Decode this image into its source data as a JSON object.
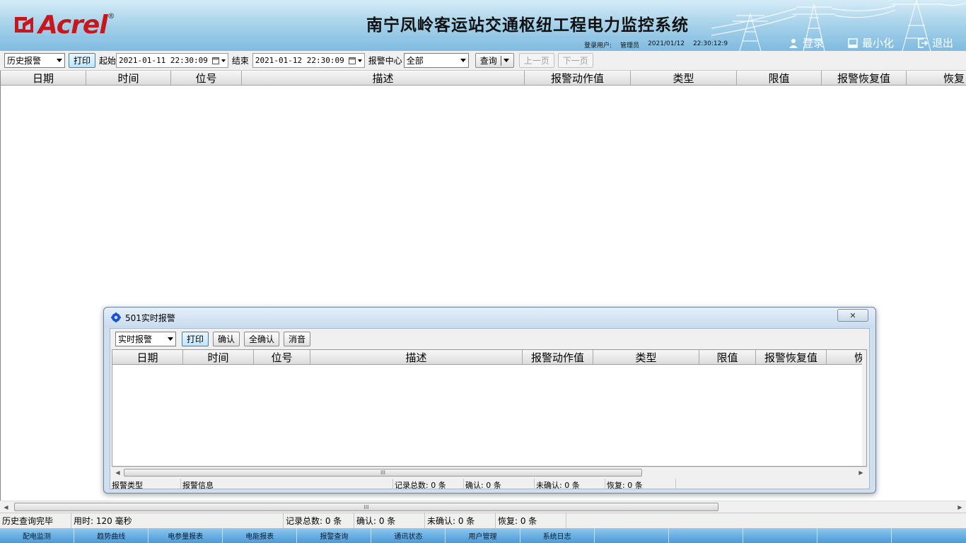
{
  "header": {
    "brand": "Acrel",
    "title": "南宁凤岭客运站交通枢纽工程电力监控系统",
    "login_label": "登录用户:",
    "login_user": "管理员",
    "date": "2021/01/12",
    "time": "22:30:12:9",
    "buttons": {
      "login": "登录",
      "minimize": "最小化",
      "exit": "退出"
    },
    "colors": {
      "brand": "#c8161d",
      "header_bg": "#a9d3ea"
    }
  },
  "toolbar": {
    "mode": "历史报警",
    "print": "打印",
    "start_label": "起始",
    "start_value": "2021-01-11  22:30:09",
    "end_label": "结束",
    "end_value": "2021-01-12  22:30:09",
    "center_label": "报警中心",
    "center_value": "全部",
    "query": "查询",
    "prev": "上一页",
    "next": "下一页"
  },
  "grid": {
    "columns": [
      "日期",
      "时间",
      "位号",
      "描述",
      "报警动作值",
      "类型",
      "限值",
      "报警恢复值",
      "恢复"
    ]
  },
  "statusbar": {
    "state": "历史查询完毕",
    "elapsed": "用时: 120 毫秒",
    "total": "记录总数: 0 条",
    "confirmed": "确认: 0 条",
    "unconfirmed": "未确认: 0 条",
    "restored": "恢复: 0 条"
  },
  "bottomnav": [
    "配电监测",
    "趋势曲线",
    "电参量报表",
    "电能报表",
    "报警查询",
    "通讯状态",
    "用户管理",
    "系统日志",
    "",
    "",
    "",
    "",
    ""
  ],
  "dialog": {
    "title": "501实时报警",
    "close": "✕",
    "mode": "实时报警",
    "buttons": [
      "打印",
      "确认",
      "全确认",
      "消音"
    ],
    "columns": [
      "日期",
      "时间",
      "位号",
      "描述",
      "报警动作值",
      "类型",
      "限值",
      "报警恢复值",
      "恢"
    ],
    "status": {
      "type": "报警类型",
      "info": "报警信息",
      "total": "记录总数: 0 条",
      "confirmed": "确认: 0 条",
      "unconfirmed": "未确认: 0 条",
      "restored": "恢复: 0 条"
    }
  },
  "scroll_grip": "III"
}
